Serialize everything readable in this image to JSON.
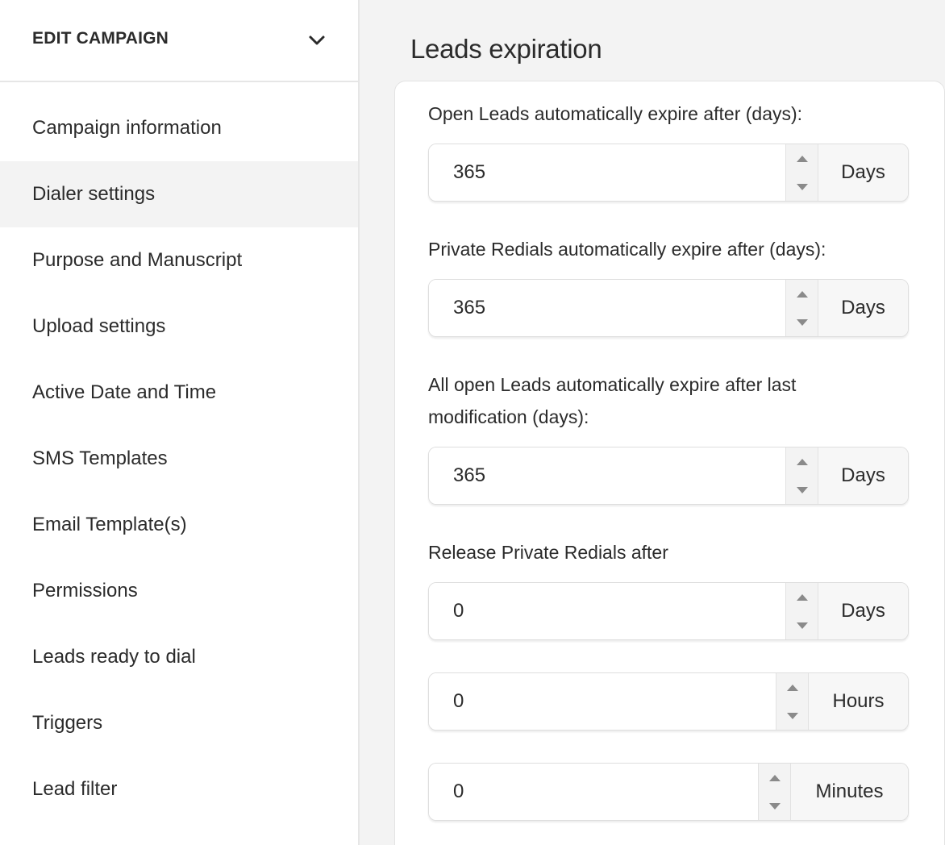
{
  "sidebar": {
    "header": {
      "title": "EDIT CAMPAIGN",
      "icon": "chevron-down-icon"
    },
    "items": [
      {
        "label": "Campaign information",
        "active": false
      },
      {
        "label": "Dialer settings",
        "active": true
      },
      {
        "label": "Purpose and Manuscript",
        "active": false
      },
      {
        "label": "Upload settings",
        "active": false
      },
      {
        "label": "Active Date and Time",
        "active": false
      },
      {
        "label": "SMS Templates",
        "active": false
      },
      {
        "label": "Email Template(s)",
        "active": false
      },
      {
        "label": "Permissions",
        "active": false
      },
      {
        "label": "Leads ready to dial",
        "active": false
      },
      {
        "label": "Triggers",
        "active": false
      },
      {
        "label": "Lead filter",
        "active": false
      }
    ]
  },
  "main": {
    "title": "Leads expiration",
    "fields": [
      {
        "label": "Open Leads automatically expire after (days):",
        "value": "365",
        "unit": "Days"
      },
      {
        "label": "Private Redials automatically expire after (days):",
        "value": "365",
        "unit": "Days"
      },
      {
        "label_line1": "All open Leads automatically expire after last",
        "label_line2": "modification (days):",
        "value": "365",
        "unit": "Days"
      },
      {
        "label": "Release Private Redials after",
        "value": "0",
        "unit": "Days"
      },
      {
        "value": "0",
        "unit": "Hours"
      },
      {
        "value": "0",
        "unit": "Minutes"
      }
    ]
  },
  "colors": {
    "active_bg": "#f3f3f3",
    "text": "#2b2b2b",
    "border": "#dedede"
  }
}
